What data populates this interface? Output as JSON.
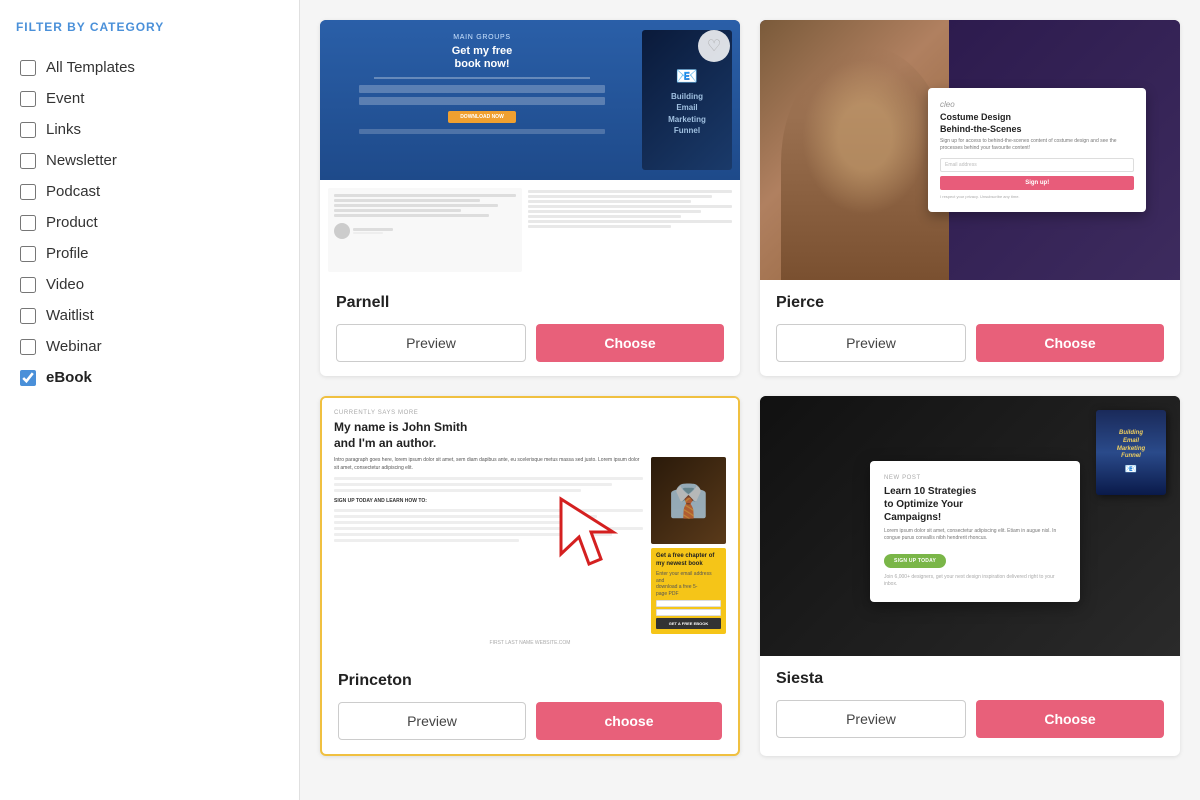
{
  "sidebar": {
    "title": "FILTER BY CATEGORY",
    "filters": [
      {
        "id": "all",
        "label": "All Templates",
        "checked": false
      },
      {
        "id": "event",
        "label": "Event",
        "checked": false
      },
      {
        "id": "links",
        "label": "Links",
        "checked": false
      },
      {
        "id": "newsletter",
        "label": "Newsletter",
        "checked": false
      },
      {
        "id": "podcast",
        "label": "Podcast",
        "checked": false
      },
      {
        "id": "product",
        "label": "Product",
        "checked": false
      },
      {
        "id": "profile",
        "label": "Profile",
        "checked": false
      },
      {
        "id": "video",
        "label": "Video",
        "checked": false
      },
      {
        "id": "waitlist",
        "label": "Waitlist",
        "checked": false
      },
      {
        "id": "webinar",
        "label": "Webinar",
        "checked": false
      },
      {
        "id": "ebook",
        "label": "eBook",
        "checked": true
      }
    ]
  },
  "templates": [
    {
      "id": "parnell",
      "name": "Parnell",
      "preview_label": "Preview",
      "choose_label": "Choose",
      "highlighted": false
    },
    {
      "id": "pierce",
      "name": "Pierce",
      "preview_label": "Preview",
      "choose_label": "Choose",
      "highlighted": false
    },
    {
      "id": "princeton",
      "name": "Princeton",
      "preview_label": "Preview",
      "choose_label": "choose",
      "highlighted": true
    },
    {
      "id": "siesta",
      "name": "Siesta",
      "preview_label": "Preview",
      "choose_label": "Choose",
      "highlighted": false
    }
  ],
  "colors": {
    "choose_btn": "#e8607a",
    "sidebar_title": "#4a90d9",
    "checkbox_accent": "#4a90d9",
    "highlight_border": "#f0c040"
  }
}
